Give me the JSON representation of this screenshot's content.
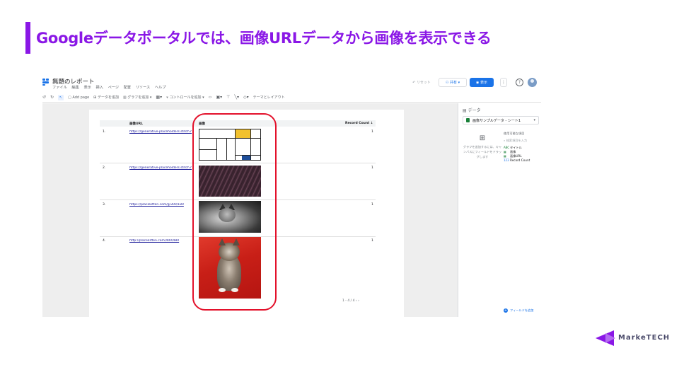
{
  "slide": {
    "title": "Googleデータポータルでは、画像URLデータから画像を表示できる"
  },
  "app": {
    "report_title": "無題のレポート",
    "menu": [
      "ファイル",
      "編集",
      "表示",
      "挿入",
      "ページ",
      "配置",
      "リソース",
      "ヘルプ"
    ],
    "reset_label": "リセット",
    "share_label": "共有",
    "view_label": "表示",
    "more_label": "⋮",
    "help_label": "?",
    "toolbar": {
      "add_page": "Add page",
      "add_data": "データを追加",
      "add_chart": "グラフを追加",
      "add_control": "コントロールを追加",
      "theme_layout": "テーマとレイアウト"
    },
    "table": {
      "headers": {
        "url": "画像URL",
        "image": "画像",
        "count": "Record Count ↓"
      },
      "rows": [
        {
          "num": "1.",
          "url": "https://generative-placeholders.stitch.me/im",
          "count": "1"
        },
        {
          "num": "2.",
          "url": "https://generative-placeholders.stitch.me/im",
          "count": "1"
        },
        {
          "num": "3.",
          "url": "https://placekitten.com/g/300/180",
          "count": "1"
        },
        {
          "num": "4.",
          "url": "http://placekitten.com/400/480",
          "count": "1"
        }
      ],
      "pager": "1 - 4 / 4   ‹   ›"
    },
    "side": {
      "title": "データ",
      "data_source": "画像サンプルデータ - シート1",
      "add_chart_hint": "グラフを追加するには、キャンバスにフィールドをドラッグします",
      "fields_head": "使用可能な項目",
      "search_placeholder": "検索項目を入力",
      "fields": [
        {
          "tag": "ABC",
          "name": "タイトル",
          "numeric": false
        },
        {
          "tag": "▦",
          "name": "画像",
          "numeric": false
        },
        {
          "tag": "▦",
          "name": "画像URL",
          "numeric": false
        },
        {
          "tag": "123",
          "name": "Record Count",
          "numeric": true
        }
      ],
      "add_field": "フィールドを追加"
    }
  },
  "brand": {
    "name": "MarkeTECH"
  },
  "colors": {
    "accent": "#8a17e6",
    "highlight": "#e3112b",
    "primary": "#1a73e8"
  }
}
